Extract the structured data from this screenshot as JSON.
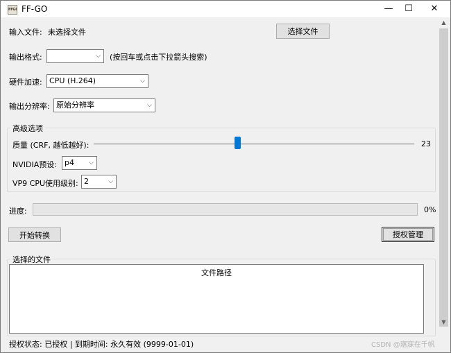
{
  "window": {
    "icon_text": "FFGO",
    "title": "FF-GO",
    "minimize_glyph": "—",
    "maximize_glyph": "☐",
    "close_glyph": "✕"
  },
  "input_file": {
    "label": "输入文件:",
    "value": "未选择文件",
    "select_button": "选择文件"
  },
  "output_format": {
    "label": "输出格式:",
    "value": "",
    "hint": "(按回车或点击下拉箭头搜索)"
  },
  "hardware_accel": {
    "label": "硬件加速:",
    "value": "CPU (H.264)"
  },
  "output_resolution": {
    "label": "输出分辨率:",
    "value": "原始分辨率"
  },
  "advanced": {
    "title": "高级选项",
    "quality_label": "质量 (CRF, 越低越好):",
    "quality_value": "23",
    "nvidia_label": "NVIDIA预设:",
    "nvidia_value": "p4",
    "vp9_label": "VP9 CPU使用级别:",
    "vp9_value": "2"
  },
  "progress": {
    "label": "进度:",
    "percent_text": "0%",
    "fraction": 0
  },
  "actions": {
    "start_button": "开始转换",
    "license_button": "授权管理"
  },
  "files": {
    "group_title": "选择的文件",
    "column_header": "文件路径"
  },
  "status": {
    "text": "授权状态: 已授权 | 到期时间: 永久有效 (9999-01-01)"
  },
  "watermark": "CSDN @寤寐在千帆",
  "icons": {
    "dropdown": "chevron-down-icon",
    "scroll_up": "scroll-up-icon",
    "scroll_down": "scroll-down-icon"
  },
  "colors": {
    "slider_thumb": "#0078d7",
    "window_bg": "#f0f0f0"
  }
}
